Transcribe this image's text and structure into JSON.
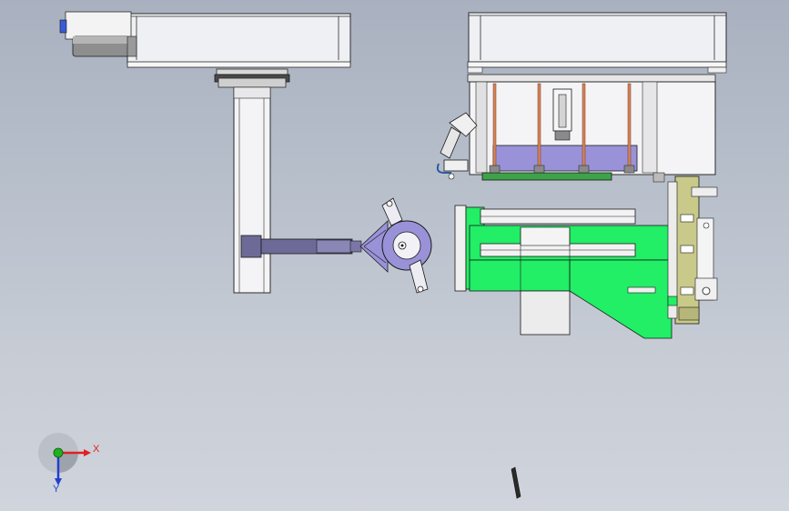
{
  "view": {
    "background_top": "#a9b1c0",
    "background_bottom": "#d0d4dc"
  },
  "triad": {
    "x_label": "X",
    "y_label": "Y",
    "x_color": "#e02020",
    "y_color": "#2040d0",
    "origin_color": "#20b020"
  },
  "colors": {
    "housing": "#eef0f3",
    "outline": "#2b2b2b",
    "green_part": "#22ee66",
    "olive_part": "#c9c98a",
    "lavender": "#9a92d8",
    "copper_rod": "#d9825a",
    "dark_purple": "#6e6a98",
    "pcb_green": "#3ea24a",
    "motor_gray": "#8e8e8e",
    "connector_blue": "#3a5bd6"
  }
}
